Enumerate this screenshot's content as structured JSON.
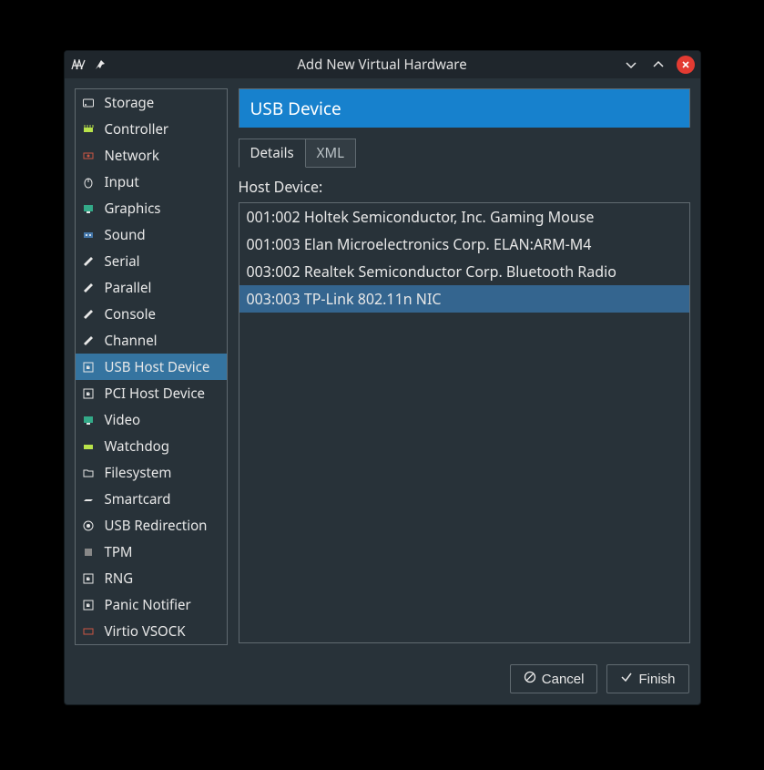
{
  "titlebar": {
    "title": "Add New Virtual Hardware",
    "app_icon": "vm-icon",
    "pin_icon": "pin-icon"
  },
  "sidebar": {
    "items": [
      {
        "id": "storage",
        "label": "Storage",
        "icon": "storage-icon"
      },
      {
        "id": "controller",
        "label": "Controller",
        "icon": "controller-icon"
      },
      {
        "id": "network",
        "label": "Network",
        "icon": "network-icon"
      },
      {
        "id": "input",
        "label": "Input",
        "icon": "input-icon"
      },
      {
        "id": "graphics",
        "label": "Graphics",
        "icon": "graphics-icon"
      },
      {
        "id": "sound",
        "label": "Sound",
        "icon": "sound-icon"
      },
      {
        "id": "serial",
        "label": "Serial",
        "icon": "serial-icon"
      },
      {
        "id": "parallel",
        "label": "Parallel",
        "icon": "parallel-icon"
      },
      {
        "id": "console",
        "label": "Console",
        "icon": "console-icon"
      },
      {
        "id": "channel",
        "label": "Channel",
        "icon": "channel-icon"
      },
      {
        "id": "usb-host",
        "label": "USB Host Device",
        "icon": "usb-host-icon",
        "selected": true
      },
      {
        "id": "pci-host",
        "label": "PCI Host Device",
        "icon": "pci-host-icon"
      },
      {
        "id": "video",
        "label": "Video",
        "icon": "video-icon"
      },
      {
        "id": "watchdog",
        "label": "Watchdog",
        "icon": "watchdog-icon"
      },
      {
        "id": "filesystem",
        "label": "Filesystem",
        "icon": "filesystem-icon"
      },
      {
        "id": "smartcard",
        "label": "Smartcard",
        "icon": "smartcard-icon"
      },
      {
        "id": "usb-redir",
        "label": "USB Redirection",
        "icon": "usb-redir-icon"
      },
      {
        "id": "tpm",
        "label": "TPM",
        "icon": "tpm-icon"
      },
      {
        "id": "rng",
        "label": "RNG",
        "icon": "rng-icon"
      },
      {
        "id": "panic",
        "label": "Panic Notifier",
        "icon": "panic-icon"
      },
      {
        "id": "vsock",
        "label": "Virtio VSOCK",
        "icon": "vsock-icon"
      }
    ]
  },
  "main": {
    "header": "USB Device",
    "tabs": {
      "details": "Details",
      "xml": "XML",
      "active": "details"
    },
    "host_label": "Host Device:",
    "devices": [
      {
        "label": "001:002 Holtek Semiconductor, Inc. Gaming Mouse"
      },
      {
        "label": "001:003 Elan Microelectronics Corp. ELAN:ARM-M4"
      },
      {
        "label": "003:002 Realtek Semiconductor Corp. Bluetooth Radio"
      },
      {
        "label": "003:003 TP-Link 802.11n NIC",
        "selected": true
      }
    ]
  },
  "footer": {
    "cancel_label": "Cancel",
    "finish_label": "Finish"
  },
  "colors": {
    "accent": "#1781cd",
    "selection": "#34658f",
    "border": "#606a70",
    "close": "#e33b32"
  }
}
